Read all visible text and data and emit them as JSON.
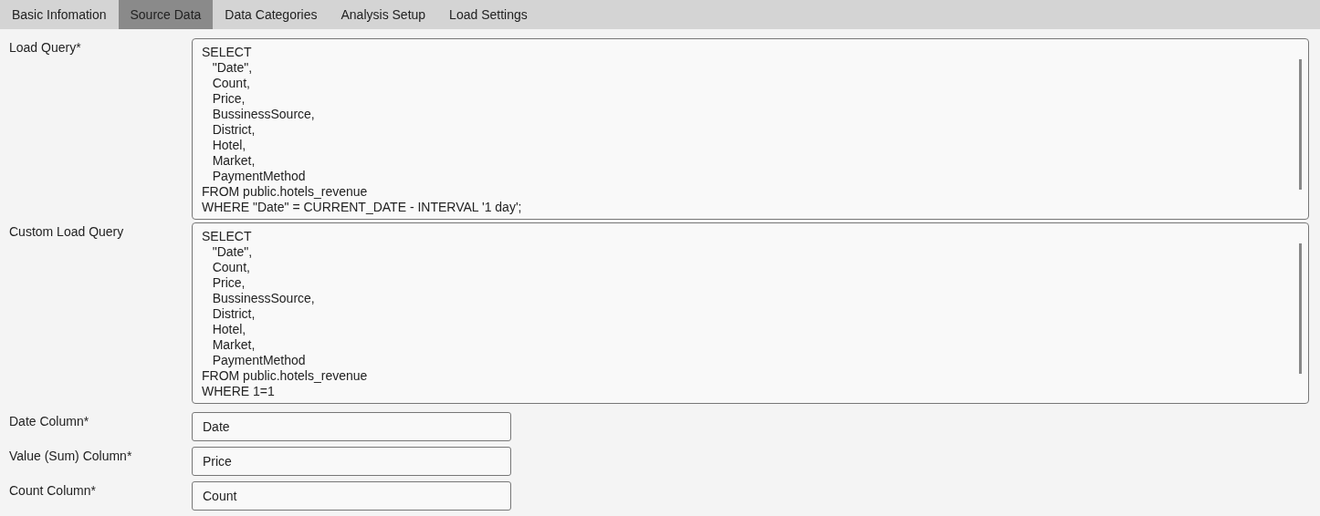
{
  "tabs": [
    {
      "label": "Basic Infomation",
      "selected": false
    },
    {
      "label": "Source Data",
      "selected": true
    },
    {
      "label": "Data Categories",
      "selected": false
    },
    {
      "label": "Analysis Setup",
      "selected": false
    },
    {
      "label": "Load Settings",
      "selected": false
    }
  ],
  "fields": [
    {
      "kind": "query",
      "label": "Load Query*",
      "value": "SELECT\n   \"Date\",\n   Count,\n   Price,\n   BussinessSource,\n   District,\n   Hotel,\n   Market,\n   PaymentMethod\nFROM public.hotels_revenue\nWHERE \"Date\" = CURRENT_DATE - INTERVAL '1 day';"
    },
    {
      "kind": "query",
      "label": "Custom Load Query",
      "value": "SELECT\n   \"Date\",\n   Count,\n   Price,\n   BussinessSource,\n   District,\n   Hotel,\n   Market,\n   PaymentMethod\nFROM public.hotels_revenue\nWHERE 1=1"
    },
    {
      "kind": "text",
      "label": "Date Column*",
      "value": "Date"
    },
    {
      "kind": "text",
      "label": "Value (Sum) Column*",
      "value": "Price"
    },
    {
      "kind": "text",
      "label": "Count Column*",
      "value": "Count"
    }
  ]
}
